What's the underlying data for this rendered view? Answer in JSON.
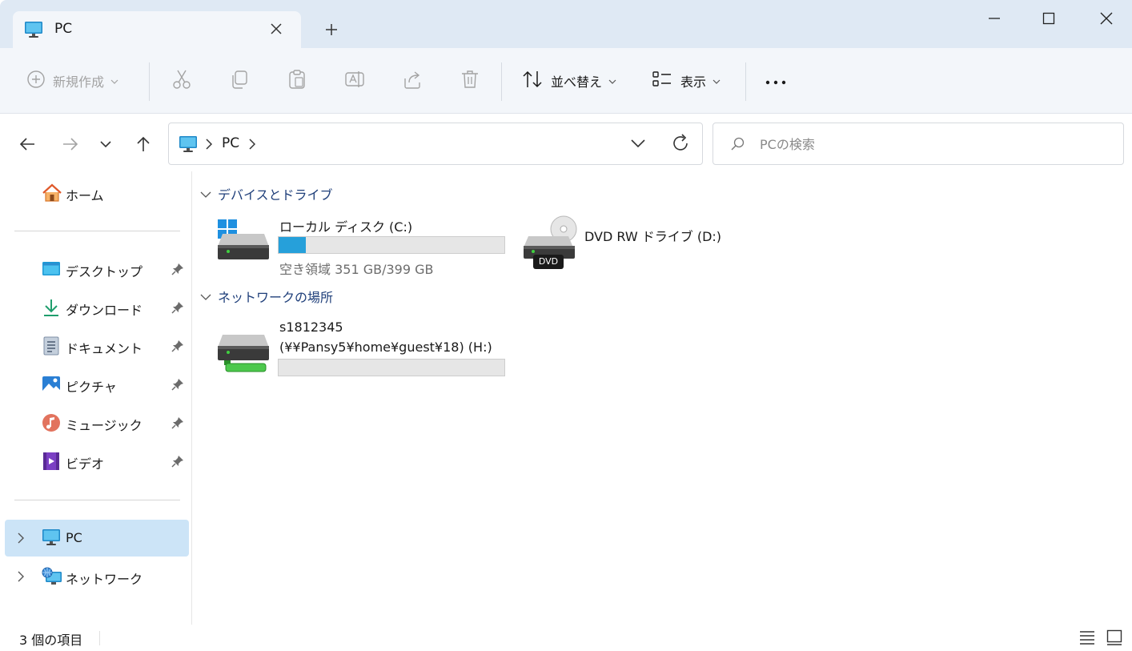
{
  "tab": {
    "title": "PC",
    "icon": "monitor-icon"
  },
  "window_controls": [
    "minimize-icon",
    "maximize-icon",
    "close-icon"
  ],
  "toolbar": {
    "new_label": "新規作成",
    "sort_label": "並べ替え",
    "view_label": "表示",
    "colors": {
      "disabled": "#a3a3a3",
      "enabled": "#1a1a1a"
    }
  },
  "address": {
    "path": "PC"
  },
  "search": {
    "placeholder": "PCの検索"
  },
  "sidebar": {
    "home": "ホーム",
    "quick_access": [
      {
        "label": "デスクトップ",
        "icon": "desktop-icon"
      },
      {
        "label": "ダウンロード",
        "icon": "download-icon"
      },
      {
        "label": "ドキュメント",
        "icon": "document-icon"
      },
      {
        "label": "ピクチャ",
        "icon": "pictures-icon"
      },
      {
        "label": "ミュージック",
        "icon": "music-icon"
      },
      {
        "label": "ビデオ",
        "icon": "video-icon"
      }
    ],
    "pc": "PC",
    "network": "ネットワーク",
    "selected_color": "#cce4f7"
  },
  "content": {
    "devices_header": "デバイスとドライブ",
    "network_header": "ネットワークの場所",
    "drive_c": {
      "name": "ローカル ディスク (C:)",
      "free": "空き領域 351 GB/399 GB",
      "used_fraction": 0.12
    },
    "drive_d": {
      "name": "DVD RW ドライブ (D:)",
      "badge": "DVD"
    },
    "drive_h": {
      "line1": "s1812345",
      "line2": "(¥¥Pansy5¥home¥guest¥18) (H:)",
      "used_fraction": 0
    },
    "accent_color": "#26a0da",
    "header_color": "#1f3f7a"
  },
  "status": {
    "count": "3 個の項目"
  }
}
